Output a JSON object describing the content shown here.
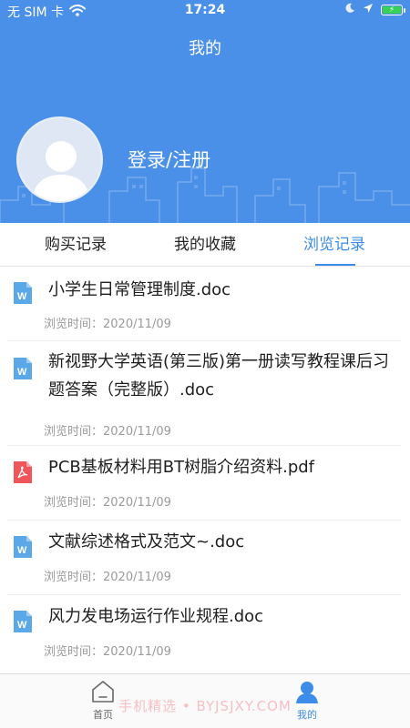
{
  "status_bar": {
    "carrier": "无 SIM 卡",
    "time": "17:24"
  },
  "header": {
    "title": "我的",
    "login_label": "登录/注册"
  },
  "tabs": [
    {
      "label": "购买记录",
      "active": false
    },
    {
      "label": "我的收藏",
      "active": false
    },
    {
      "label": "浏览记录",
      "active": true
    }
  ],
  "history": [
    {
      "title": "小学生日常管理制度.doc",
      "meta": "浏览时间：2020/11/09",
      "type": "doc"
    },
    {
      "title": "新视野大学英语(第三版)第一册读写教程课后习题答案（完整版）.doc",
      "meta": "浏览时间：2020/11/09",
      "type": "doc"
    },
    {
      "title": "PCB基板材料用BT树脂介绍资料.pdf",
      "meta": "浏览时间：2020/11/09",
      "type": "pdf"
    },
    {
      "title": "文献综述格式及范文~.doc",
      "meta": "浏览时间：2020/11/09",
      "type": "doc"
    },
    {
      "title": "风力发电场运行作业规程.doc",
      "meta": "浏览时间：2020/11/09",
      "type": "doc"
    }
  ],
  "bottom_nav": [
    {
      "label": "首页",
      "icon": "home-icon",
      "active": false
    },
    {
      "label": "我的",
      "icon": "user-icon",
      "active": true
    }
  ],
  "watermark": "手机精选 • BYJSJXY.COM",
  "colors": {
    "header_bg": "#4a8fe8",
    "accent": "#3d8ce8",
    "doc_icon": "#5aa8e8",
    "pdf_icon": "#f0555a",
    "battery_fill": "#37d159"
  }
}
